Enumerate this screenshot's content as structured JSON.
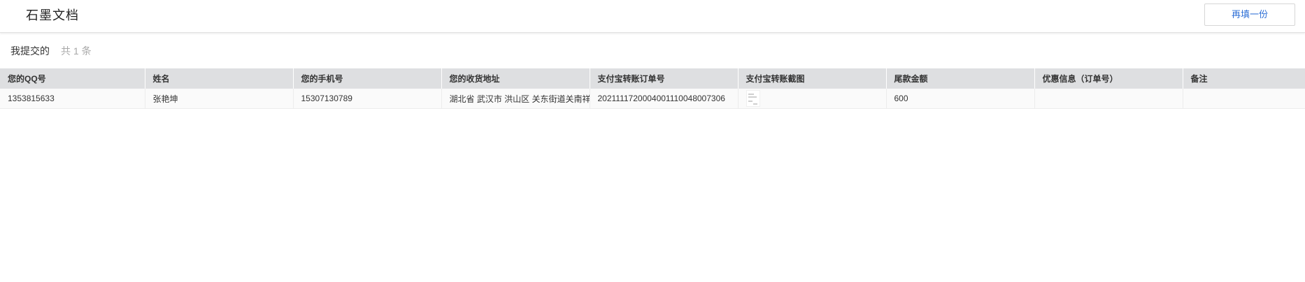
{
  "header": {
    "brand": "石墨文档",
    "refill_label": "再填一份"
  },
  "section": {
    "title": "我提交的",
    "count": "共 1 条"
  },
  "table": {
    "columns": [
      "您的QQ号",
      "姓名",
      "您的手机号",
      "您的收货地址",
      "支付宝转账订单号",
      "支付宝转账截图",
      "尾款金额",
      "优惠信息（订单号）",
      "备注"
    ],
    "rows": [
      {
        "qq": "1353815633",
        "name": "张艳坤",
        "phone": "15307130789",
        "address": "湖北省 武汉市 洪山区 关东街道关南祥",
        "order_no": "2021111720004001110048007306",
        "screenshot_icon": "image-thumbnail-icon",
        "balance": "600",
        "discount": "",
        "note": ""
      }
    ]
  },
  "colors": {
    "accent": "#2e6fd6",
    "header_bg": "#dedfe1",
    "muted": "#a8a8a8"
  }
}
